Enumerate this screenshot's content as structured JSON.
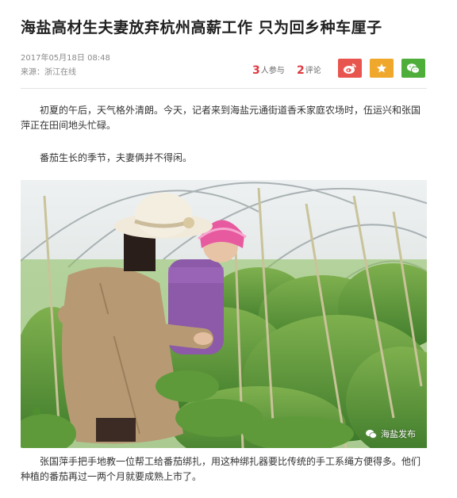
{
  "article": {
    "title": "海盐高材生夫妻放弃杭州高薪工作  只为回乡种车厘子",
    "date": "2017年05月18日  08:48",
    "source": "来源：浙江在线"
  },
  "stats": {
    "join_count": "3",
    "join_label": "人参与",
    "comment_count": "2",
    "comment_label": "评论"
  },
  "share": {
    "buttons": [
      {
        "name": "weibo",
        "icon": "weibo-icon",
        "color": "#e8554e"
      },
      {
        "name": "favorite",
        "icon": "star-icon",
        "color": "#efa82c"
      },
      {
        "name": "wechat",
        "icon": "wechat-icon",
        "color": "#4fae3a"
      }
    ]
  },
  "body": {
    "paragraphs": [
      "初夏的午后，天气格外清朗。今天，记者来到海盐元通街道香禾家庭农场时，伍运兴和张国萍正在田间地头忙碌。",
      "番茄生长的季节，夫妻俩并不得闲。"
    ],
    "photo_watermark": "海盐发布",
    "caption": "张国萍手把手地教一位帮工给番茄绑扎，用这种绑扎器要比传统的手工系绳方便得多。他们种植的番茄再过一两个月就要成熟上市了。"
  }
}
